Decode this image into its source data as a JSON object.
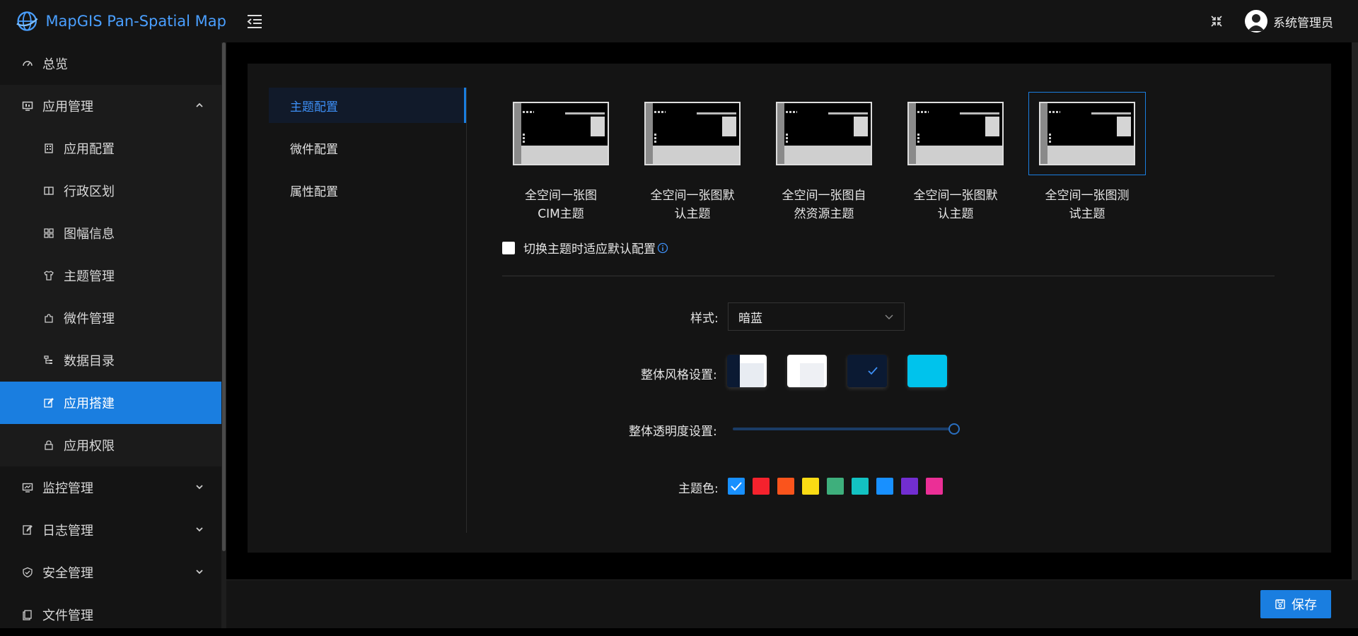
{
  "app": {
    "title": "MapGIS Pan-Spatial Map"
  },
  "header": {
    "username": "系统管理员"
  },
  "sidebar": {
    "items": [
      {
        "label": "总览"
      },
      {
        "label": "应用管理"
      },
      {
        "label": "应用配置"
      },
      {
        "label": "行政区划"
      },
      {
        "label": "图幅信息"
      },
      {
        "label": "主题管理"
      },
      {
        "label": "微件管理"
      },
      {
        "label": "数据目录"
      },
      {
        "label": "应用搭建"
      },
      {
        "label": "应用权限"
      },
      {
        "label": "监控管理"
      },
      {
        "label": "日志管理"
      },
      {
        "label": "安全管理"
      },
      {
        "label": "文件管理"
      }
    ]
  },
  "subnav": {
    "items": [
      {
        "label": "主题配置"
      },
      {
        "label": "微件配置"
      },
      {
        "label": "属性配置"
      }
    ]
  },
  "themes": [
    {
      "line1": "全空间一张图",
      "line2": "CIM主题"
    },
    {
      "line1": "全空间一张图默",
      "line2": "认主题"
    },
    {
      "line1": "全空间一张图自",
      "line2": "然资源主题"
    },
    {
      "line1": "全空间一张图默",
      "line2": "认主题"
    },
    {
      "line1": "全空间一张图测",
      "line2": "试主题"
    }
  ],
  "checkbox": {
    "label": "切换主题时适应默认配置"
  },
  "form": {
    "style_label": "样式:",
    "style_value": "暗蓝",
    "overall_style_label": "整体风格设置:",
    "opacity_label": "整体透明度设置:",
    "opacity_value": 1.0,
    "theme_color_label": "主题色:"
  },
  "colors": {
    "accent": "#1a7ee0",
    "swatches": [
      "#1890ff",
      "#f5222d",
      "#fa541c",
      "#fadb14",
      "#3eaf7c",
      "#13c2c2",
      "#1890ff",
      "#722ed1",
      "#eb2f96"
    ]
  },
  "footer": {
    "save_label": "保存"
  }
}
